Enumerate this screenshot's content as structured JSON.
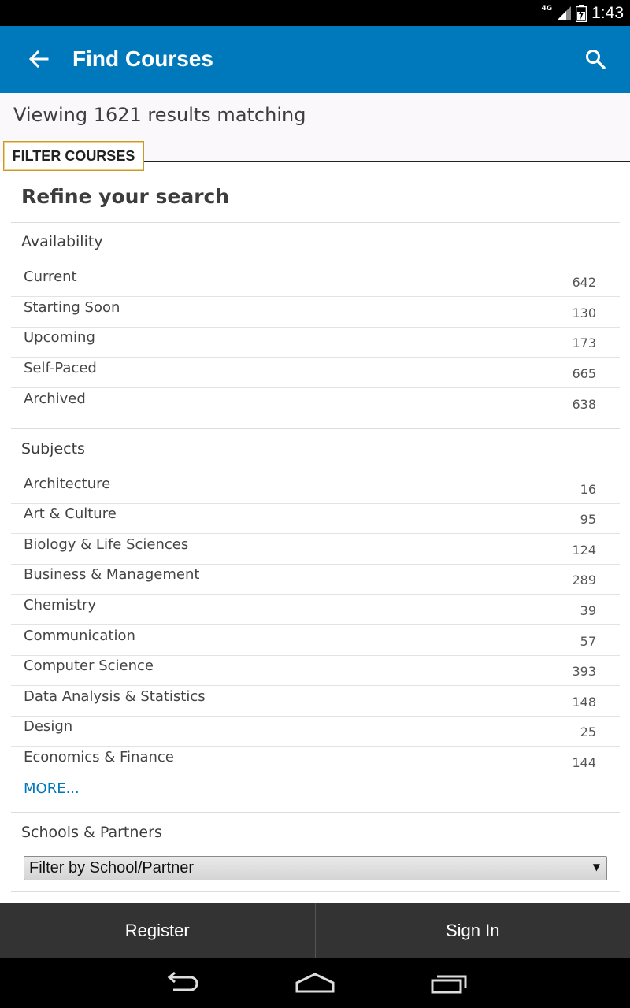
{
  "status_bar": {
    "network": "4G",
    "time": "1:43"
  },
  "action_bar": {
    "title": "Find Courses",
    "back_icon": "arrow-back-icon",
    "search_icon": "search-icon",
    "color": "#0079bc"
  },
  "results": {
    "text": "Viewing 1621 results matching",
    "filter_tab_label": "FILTER COURSES"
  },
  "refine": {
    "title": "Refine your search",
    "availability": {
      "title": "Availability",
      "items": [
        {
          "label": "Current",
          "count": "642"
        },
        {
          "label": "Starting Soon",
          "count": "130"
        },
        {
          "label": "Upcoming",
          "count": "173"
        },
        {
          "label": "Self-Paced",
          "count": "665"
        },
        {
          "label": "Archived",
          "count": "638"
        }
      ]
    },
    "subjects": {
      "title": "Subjects",
      "items": [
        {
          "label": "Architecture",
          "count": "16"
        },
        {
          "label": "Art & Culture",
          "count": "95"
        },
        {
          "label": "Biology & Life Sciences",
          "count": "124"
        },
        {
          "label": "Business & Management",
          "count": "289"
        },
        {
          "label": "Chemistry",
          "count": "39"
        },
        {
          "label": "Communication",
          "count": "57"
        },
        {
          "label": "Computer Science",
          "count": "393"
        },
        {
          "label": "Data Analysis & Statistics",
          "count": "148"
        },
        {
          "label": "Design",
          "count": "25"
        },
        {
          "label": "Economics & Finance",
          "count": "144"
        }
      ],
      "more_label": "MORE..."
    },
    "schools": {
      "title": "Schools & Partners",
      "select_value": "Filter by School/Partner"
    }
  },
  "bottom_bar": {
    "register_label": "Register",
    "signin_label": "Sign In"
  },
  "nav_bar": {
    "back_icon": "nav-back-icon",
    "home_icon": "nav-home-icon",
    "recents_icon": "nav-recents-icon"
  }
}
